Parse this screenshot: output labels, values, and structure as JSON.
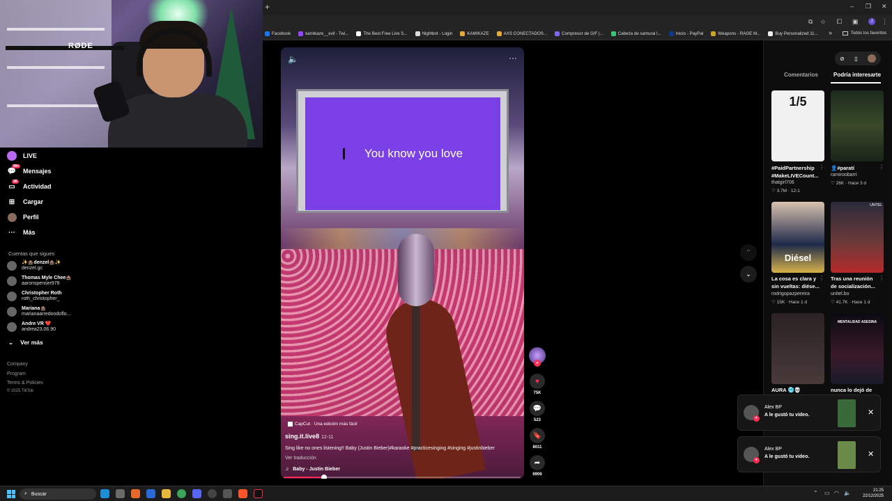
{
  "webcam": {
    "brand": "RØDE"
  },
  "sidebar": {
    "nav": [
      {
        "label": "LIVE",
        "icon": "live-icon"
      },
      {
        "label": "Mensajes",
        "icon": "messages-icon",
        "badge": "99+"
      },
      {
        "label": "Actividad",
        "icon": "activity-icon",
        "badge": "38"
      },
      {
        "label": "Cargar",
        "icon": "upload-icon"
      },
      {
        "label": "Perfil",
        "icon": "profile-avatar"
      },
      {
        "label": "Más",
        "icon": "more-icon"
      }
    ],
    "following_title": "Cuentas que sigues",
    "following": [
      {
        "name": "✨🏚️denzel🏚️✨",
        "handle": "denzel.gc"
      },
      {
        "name": "Thomas Myle Chee🏚️",
        "handle": "aaronspenser978"
      },
      {
        "name": "Christopher Roth",
        "handle": "roth_christopher_"
      },
      {
        "name": "Mariana🏚️",
        "handle": "marianaarredondoflo..."
      },
      {
        "name": "Andre VR ❤️",
        "handle": "andrea23.06.90"
      }
    ],
    "see_more": "Ver más",
    "footer": [
      "Company",
      "Program",
      "Terms & Policies",
      "© 2025 TikTok"
    ]
  },
  "browser": {
    "bookmarks": [
      "Facebook",
      "kamikaze__evil - Twi...",
      "The Best Free Live S...",
      "Nightbot - Login",
      "KAMIKAZE",
      "AXS CONECTADOS...",
      "Compresor de GIF |...",
      "Cabeza de samurai l...",
      "Inicio - PayPal",
      "Weapons - RAGE M...",
      "Buy Personalized 11..."
    ],
    "all_bookmarks": "Todos los favoritos",
    "profile_initial": "J"
  },
  "video": {
    "lyric": "You know you love",
    "capcut": "CapCut · Una edición más fácil",
    "author": "sing.it.live8",
    "date": "12-11",
    "description": "Sing like no ones listening!! Baby (Justin Bieber)#karaoke #practicesinging #singing #justinbieber",
    "translate": "Ver traducción",
    "music": "Baby - Justin Bieber",
    "progress": 0.17
  },
  "actions": {
    "likes": "75K",
    "comments": "523",
    "saves": "8011",
    "shares": "6906"
  },
  "panel": {
    "tabs": [
      "Comentarios",
      "Podría interesarte"
    ],
    "tiles": [
      {
        "caption1": "#PaidPartnership",
        "caption2": "#MakeLIVECount...",
        "user": "thatgirl706",
        "likes": "3.7M",
        "date": "12-1",
        "overlay": "1/5"
      },
      {
        "caption1": "👤#paratí",
        "caption2": "",
        "user": "ramiroobarri",
        "likes": "26K",
        "date": "Hace 3 d",
        "overlay": ""
      },
      {
        "caption1": "La cosa es clara y",
        "caption2": "sin vueltas: diése...",
        "user": "rodrigopazpereira",
        "likes": "15K",
        "date": "Hace 1 d",
        "overlay": "Diésel"
      },
      {
        "caption1": "Tras una reunión",
        "caption2": "de socialización...",
        "user": "unitel.bo",
        "likes": "41.7K",
        "date": "Hace 1 d",
        "overlay": "UNITEL"
      },
      {
        "caption1": "AURA 🥶💀",
        "caption2": "",
        "user": "",
        "likes": "",
        "date": "",
        "overlay": ""
      },
      {
        "caption1": "nunca lo dejó de",
        "caption2": "",
        "user": "",
        "likes": "",
        "date": "",
        "overlay": "MENTALIDAD ASESINA"
      }
    ]
  },
  "notifications": [
    {
      "name": "Alex BP",
      "message": "A le gustó tu video."
    },
    {
      "name": "Alex BP",
      "message": "A le gustó tu video."
    }
  ],
  "taskbar": {
    "search": "Buscar",
    "time": "21:25",
    "date": "22/12/2025"
  },
  "colors": {
    "accent": "#fe2c55",
    "screen": "#7a3fe5",
    "bg": "#000000"
  }
}
